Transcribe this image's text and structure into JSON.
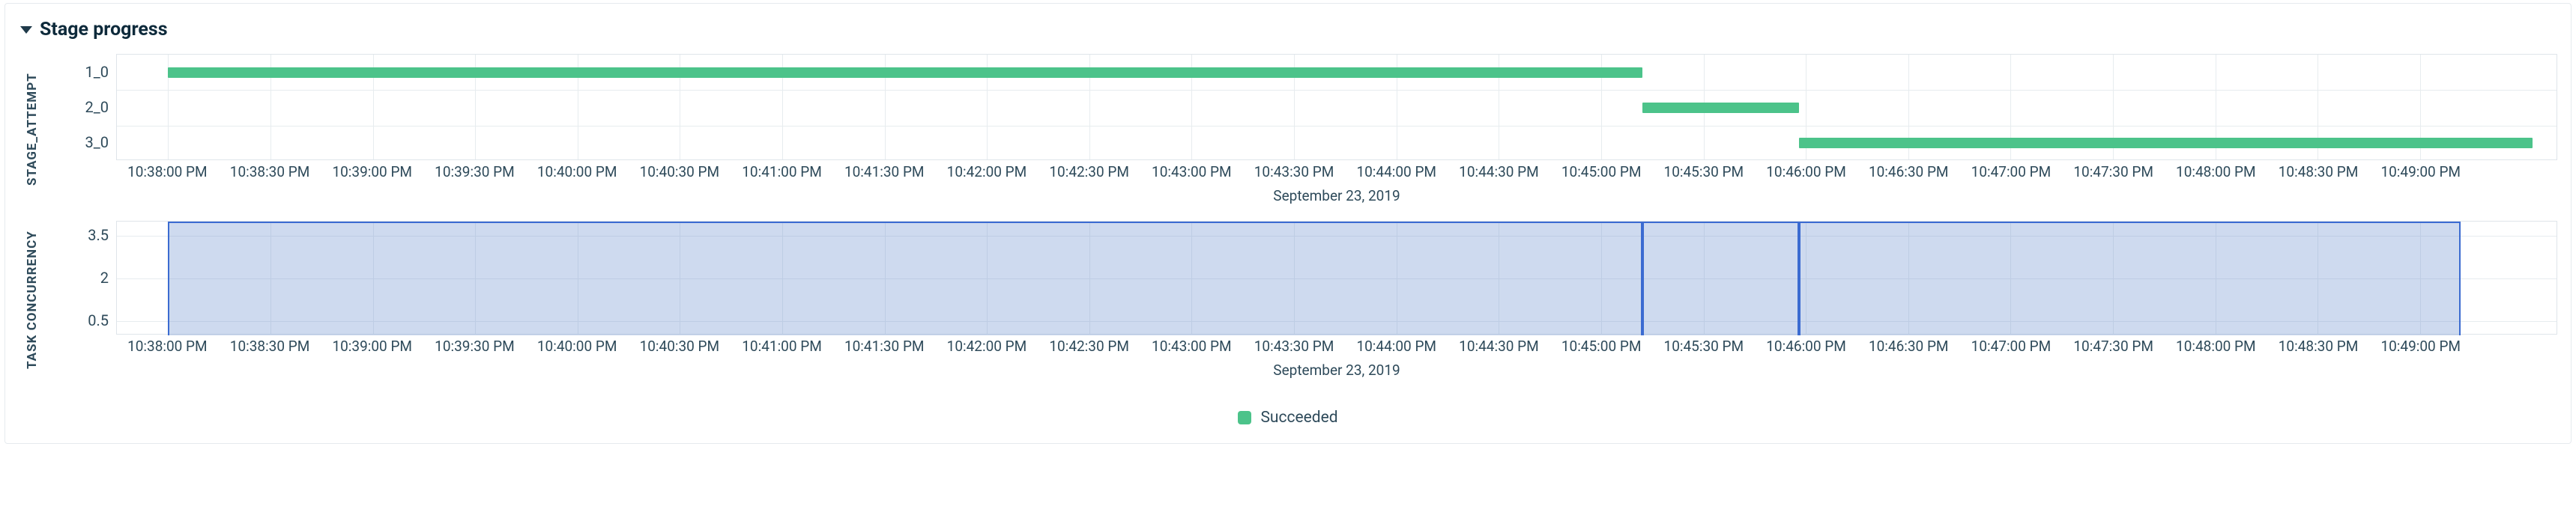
{
  "panel": {
    "title": "Stage progress"
  },
  "colors": {
    "succeeded": "#4cc38a",
    "area_fill": "rgba(115,148,210,0.35)",
    "area_stroke": "#3b6bd1"
  },
  "legend": {
    "items": [
      {
        "label": "Succeeded",
        "color_key": "succeeded"
      }
    ]
  },
  "time_axis": {
    "ticks": [
      "10:38:00 PM",
      "10:38:30 PM",
      "10:39:00 PM",
      "10:39:30 PM",
      "10:40:00 PM",
      "10:40:30 PM",
      "10:41:00 PM",
      "10:41:30 PM",
      "10:42:00 PM",
      "10:42:30 PM",
      "10:43:00 PM",
      "10:43:30 PM",
      "10:44:00 PM",
      "10:44:30 PM",
      "10:45:00 PM",
      "10:45:30 PM",
      "10:46:00 PM",
      "10:46:30 PM",
      "10:47:00 PM",
      "10:47:30 PM",
      "10:48:00 PM",
      "10:48:30 PM",
      "10:49:00 PM"
    ],
    "title": "September 23, 2019",
    "domain_seconds": [
      -15,
      700
    ]
  },
  "chart_data": [
    {
      "type": "bar",
      "id": "stage_attempt",
      "ylabel": "STAGE_ATTEMPT",
      "categories": [
        "1_0",
        "2_0",
        "3_0"
      ],
      "series": [
        {
          "name": "Succeeded",
          "color_key": "succeeded",
          "bars": [
            {
              "category": "1_0",
              "start_s": 0,
              "end_s": 432
            },
            {
              "category": "2_0",
              "start_s": 432,
              "end_s": 478
            },
            {
              "category": "3_0",
              "start_s": 478,
              "end_s": 693
            }
          ]
        }
      ],
      "xlabel": "September 23, 2019"
    },
    {
      "type": "area",
      "id": "task_concurrency",
      "ylabel": "TASK CONCURRENCY",
      "yticks": [
        0.5,
        2,
        3.5
      ],
      "ylim": [
        0,
        4
      ],
      "segments": [
        {
          "start_s": 0,
          "end_s": 432,
          "value": 4
        },
        {
          "start_s": 432,
          "end_s": 478,
          "value": 4
        },
        {
          "start_s": 478,
          "end_s": 672,
          "value": 4
        }
      ],
      "xlabel": "September 23, 2019"
    }
  ]
}
